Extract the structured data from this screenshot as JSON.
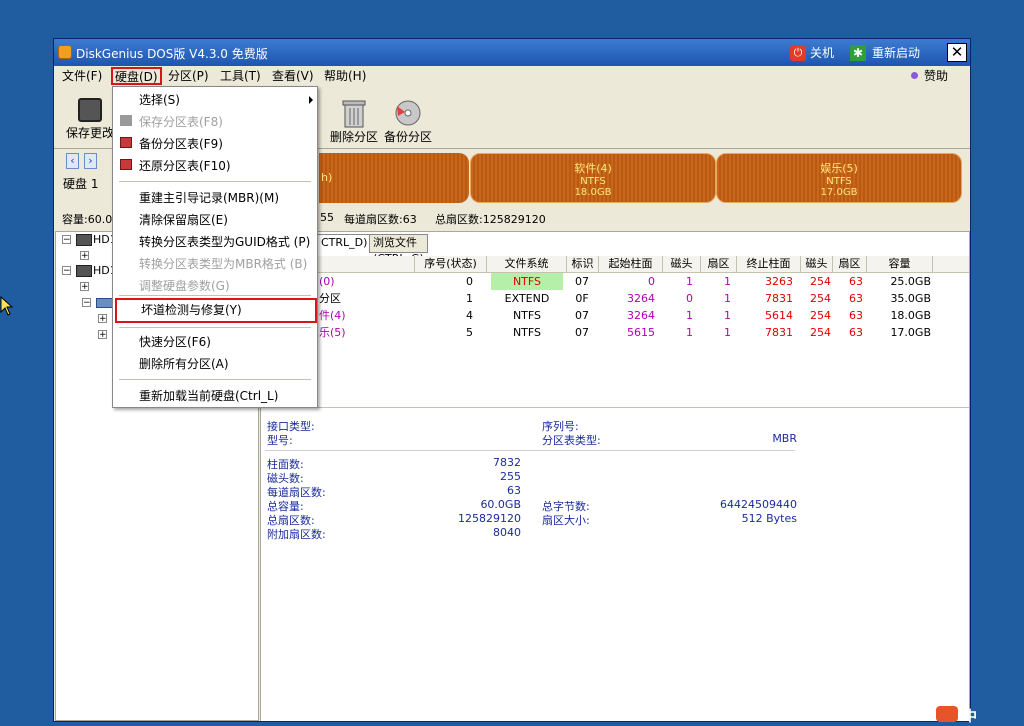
{
  "window": {
    "title": "DiskGenius DOS版 V4.3.0 免费版",
    "shutdown_label": "关机",
    "restart_label": "重新启动",
    "close_label": "✕"
  },
  "menubar": {
    "items": [
      "文件(F)",
      "硬盘(D)",
      "分区(P)",
      "工具(T)",
      "查看(V)",
      "帮助(H)"
    ],
    "sponsor_label": "赞助"
  },
  "toolbar": {
    "save_label": "保存更改",
    "delete_label": "删除分区",
    "backup_label": "备份分区"
  },
  "diskbar": {
    "disk_label": "硬盘 1",
    "capacity_prefix": "容量:60.0",
    "partitions": [
      {
        "name": "h)",
        "fs": "",
        "size": ""
      },
      {
        "name": "软件(4)",
        "fs": "NTFS",
        "size": "18.0GB"
      },
      {
        "name": "娱乐(5)",
        "fs": "NTFS",
        "size": "17.0GB"
      }
    ]
  },
  "info_line": {
    "heads": "55",
    "sectors_per_track": "每道扇区数:63",
    "total_sectors": "总扇区数:125829120"
  },
  "tree": {
    "nodes": [
      "HD1",
      "HD1"
    ]
  },
  "tabs": [
    "CTRL_D)",
    "浏览文件(CTRL_G)"
  ],
  "table": {
    "headers": [
      "序号(状态)",
      "文件系统",
      "标识",
      "起始柱面",
      "磁头",
      "扇区",
      "终止柱面",
      "磁头",
      "扇区",
      "容量"
    ],
    "rows": [
      {
        "name": "(0)",
        "idx": "0",
        "fs": "NTFS",
        "id": "07",
        "sc": "0",
        "sh": "1",
        "ss": "1",
        "ec": "3263",
        "eh": "254",
        "es": "63",
        "cap": "25.0GB"
      },
      {
        "name": "分区",
        "idx": "1",
        "fs": "EXTEND",
        "id": "0F",
        "sc": "3264",
        "sh": "0",
        "ss": "1",
        "ec": "7831",
        "eh": "254",
        "es": "63",
        "cap": "35.0GB"
      },
      {
        "name": "件(4)",
        "idx": "4",
        "fs": "NTFS",
        "id": "07",
        "sc": "3264",
        "sh": "1",
        "ss": "1",
        "ec": "5614",
        "eh": "254",
        "es": "63",
        "cap": "18.0GB"
      },
      {
        "name": "乐(5)",
        "idx": "5",
        "fs": "NTFS",
        "id": "07",
        "sc": "5615",
        "sh": "1",
        "ss": "1",
        "ec": "7831",
        "eh": "254",
        "es": "63",
        "cap": "17.0GB"
      }
    ]
  },
  "detail": {
    "interface_label": "接口类型:",
    "model_label": "型号:",
    "serial_label": "序列号:",
    "pt_type_label": "分区表类型:",
    "pt_type_value": "MBR",
    "cylinders_label": "柱面数:",
    "cylinders_value": "7832",
    "heads_label": "磁头数:",
    "heads_value": "255",
    "spt_label": "每道扇区数:",
    "spt_value": "63",
    "capacity_label": "总容量:",
    "capacity_value": "60.0GB",
    "total_bytes_label": "总字节数:",
    "total_bytes_value": "64424509440",
    "total_sectors_label": "总扇区数:",
    "total_sectors_value": "125829120",
    "sector_size_label": "扇区大小:",
    "sector_size_value": "512 Bytes",
    "extra_sectors_label": "附加扇区数:",
    "extra_sectors_value": "8040"
  },
  "dropdown": {
    "items": [
      {
        "label": "选择(S)",
        "disabled": false
      },
      {
        "label": "保存分区表(F8)",
        "disabled": true
      },
      {
        "label": "备份分区表(F9)",
        "disabled": false
      },
      {
        "label": "还原分区表(F10)",
        "disabled": false
      },
      {
        "label": "重建主引导记录(MBR)(M)",
        "disabled": false
      },
      {
        "label": "清除保留扇区(E)",
        "disabled": false
      },
      {
        "label": "转换分区表类型为GUID格式 (P)",
        "disabled": false
      },
      {
        "label": "转换分区表类型为MBR格式 (B)",
        "disabled": true
      },
      {
        "label": "调整硬盘参数(G)",
        "disabled": true
      },
      {
        "label": "坏道检测与修复(Y)",
        "disabled": false
      },
      {
        "label": "快速分区(F6)",
        "disabled": false
      },
      {
        "label": "删除所有分区(A)",
        "disabled": false
      },
      {
        "label": "重新加载当前硬盘(Ctrl_L)",
        "disabled": false
      }
    ]
  },
  "tray": {
    "ime_label": "中"
  },
  "colors": {
    "desktop": "#1f5da0",
    "highlight": "#d9141b",
    "partition": "#c8661a"
  }
}
